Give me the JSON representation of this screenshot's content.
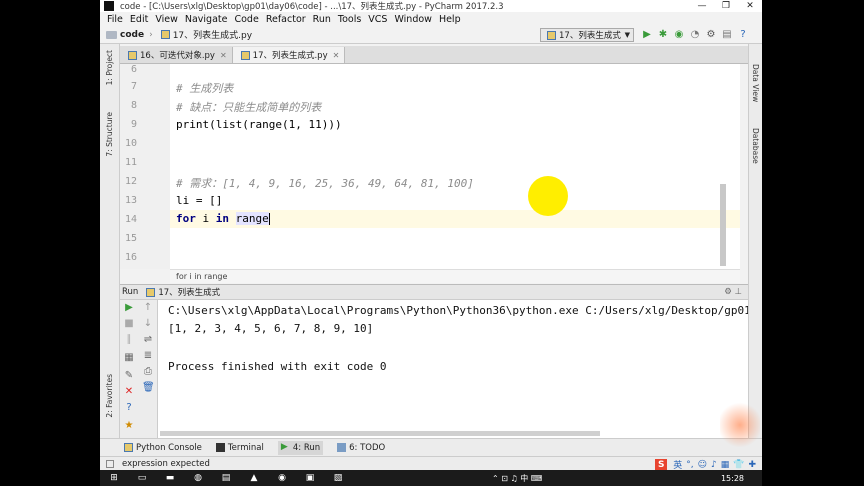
{
  "window": {
    "title": "code - [C:\\Users\\xlg\\Desktop\\gp01\\day06\\code] - ...\\17、列表生成式.py - PyCharm 2017.2.3",
    "controls": [
      "—",
      "❐",
      "✕"
    ]
  },
  "menu": [
    "File",
    "Edit",
    "View",
    "Navigate",
    "Code",
    "Refactor",
    "Run",
    "Tools",
    "VCS",
    "Window",
    "Help"
  ],
  "nav": {
    "project": "code",
    "file": "17、列表生成式.py",
    "run_config": "17、列表生成式"
  },
  "tabs": [
    {
      "label": "16、可迭代对象.py",
      "active": false
    },
    {
      "label": "17、列表生成式.py",
      "active": true
    }
  ],
  "left_tools": [
    "1: Project",
    "7: Structure",
    "2: Favorites"
  ],
  "right_tools": [
    "Data View",
    "Database"
  ],
  "editor": {
    "line_numbers": [
      "6",
      "7",
      "8",
      "9",
      "10",
      "11",
      "12",
      "13",
      "14",
      "15",
      "16"
    ],
    "lines": {
      "l7": "# 生成列表",
      "l8": "# 缺点：只能生成简单的列表",
      "l9": "print(list(range(1, 11)))",
      "l12": "# 需求：[1, 4, 9, 16, 25, 36, 49, 64, 81, 100]",
      "l13": "li = []",
      "l14_kw1": "for",
      "l14_var": " i ",
      "l14_kw2": "in",
      "l14_word": "range"
    },
    "breadcrumb": "for i in range"
  },
  "run": {
    "label": "Run",
    "tab": "17、列表生成式",
    "output": [
      "C:\\Users\\xlg\\AppData\\Local\\Programs\\Python\\Python36\\python.exe C:/Users/xlg/Desktop/gp01/day",
      "[1, 2, 3, 4, 5, 6, 7, 8, 9, 10]",
      "",
      "Process finished with exit code 0"
    ]
  },
  "tool_tabs": [
    "Python Console",
    "Terminal",
    "4: Run",
    "6: TODO"
  ],
  "status": {
    "message": "expression expected",
    "ime": "英"
  },
  "taskbar": {
    "clock": "15:28"
  },
  "colors": {
    "keyword": "#000080",
    "comment": "#8c8c8c",
    "run_green": "#3a9b3a",
    "highlight": "#ffee00"
  }
}
